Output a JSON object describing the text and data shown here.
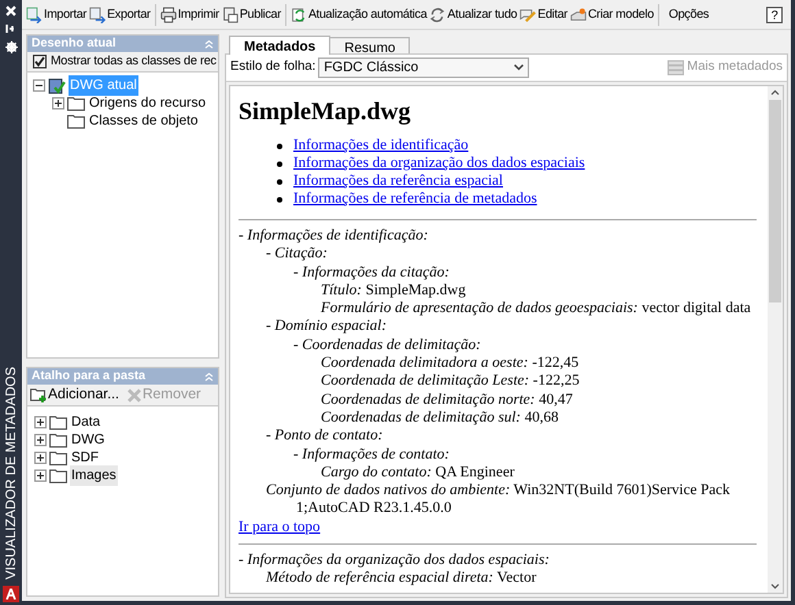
{
  "side_strip": {
    "title": "VISUALIZADOR DE METADADOS"
  },
  "toolbar": {
    "groups": [
      [
        "Importar",
        "Exportar"
      ],
      [
        "Imprimir",
        "Publicar"
      ],
      [
        "Atualização automática",
        "Atualizar tudo",
        "Editar",
        "Criar modelo"
      ],
      [
        "Opções"
      ]
    ],
    "help": "?"
  },
  "current_drawing": {
    "title": "Desenho atual",
    "show_all": {
      "label": "Mostrar todas as classes de rec",
      "checked": true
    },
    "tree": [
      {
        "label": "DWG atual",
        "selected": true,
        "expandable": true,
        "expanded": true,
        "children": [
          {
            "label": "Origens do recurso",
            "selected": false,
            "expandable": true,
            "expanded": false
          },
          {
            "label": "Classes de objeto",
            "selected": false,
            "expandable": false
          }
        ]
      }
    ]
  },
  "folder_shortcuts": {
    "title": "Atalho para a pasta",
    "add": "Adicionar...",
    "remove": {
      "label": "Remover",
      "disabled": true
    },
    "items": [
      {
        "label": "Data",
        "selected": false
      },
      {
        "label": "DWG",
        "selected": false
      },
      {
        "label": "SDF",
        "selected": false
      },
      {
        "label": "Images",
        "selected": true
      }
    ]
  },
  "tabs": [
    {
      "label": "Metadados",
      "selected": true
    },
    {
      "label": "Resumo",
      "selected": false
    }
  ],
  "sheet_style": {
    "label": "Estilo de folha:",
    "value": "FGDC Clássico"
  },
  "more_metadata": {
    "label": "Mais metadados",
    "disabled": true
  },
  "document": {
    "title": "SimpleMap.dwg",
    "links": [
      "Informações de identificação",
      "Informações da organização dos dados espaciais",
      "Informações da referência espacial",
      "Informações de referência de metadados"
    ],
    "sections": [
      {
        "heading": "- Informações de identificação:",
        "children": [
          {
            "heading": "- Citação:",
            "children": [
              {
                "heading": "- Informações da citação:",
                "children": [
                  {
                    "label": "Título:",
                    "value": "SimpleMap.dwg"
                  },
                  {
                    "label": "Formulário de apresentação de dados geoespaciais:",
                    "value": "vector digital data"
                  }
                ]
              }
            ]
          },
          {
            "heading": "- Domínio espacial:",
            "children": [
              {
                "heading": "- Coordenadas de delimitação:",
                "children": [
                  {
                    "label": "Coordenada delimitadora a oeste:",
                    "value": "-122,45"
                  },
                  {
                    "label": "Coordenada de delimitação Leste:",
                    "value": "-122,25"
                  },
                  {
                    "label": "Coordenadas de delimitação norte:",
                    "value": "40,47"
                  },
                  {
                    "label": "Coordenadas de delimitação sul:",
                    "value": "40,68"
                  }
                ]
              }
            ]
          },
          {
            "heading": "- Ponto de contato:",
            "children": [
              {
                "heading": "- Informações de contato:",
                "children": [
                  {
                    "label": "Cargo do contato:",
                    "value": "QA Engineer"
                  }
                ]
              }
            ]
          },
          {
            "label": "Conjunto de dados nativos do ambiente:",
            "value": "Win32NT(Build 7601)Service Pack 1;AutoCAD R23.1.45.0.0"
          }
        ],
        "back_link": "Ir para o topo"
      },
      {
        "heading": "- Informações da organização dos dados espaciais:",
        "children": [
          {
            "label": "Método de referência espacial direta:",
            "value": "Vector"
          }
        ]
      }
    ]
  }
}
